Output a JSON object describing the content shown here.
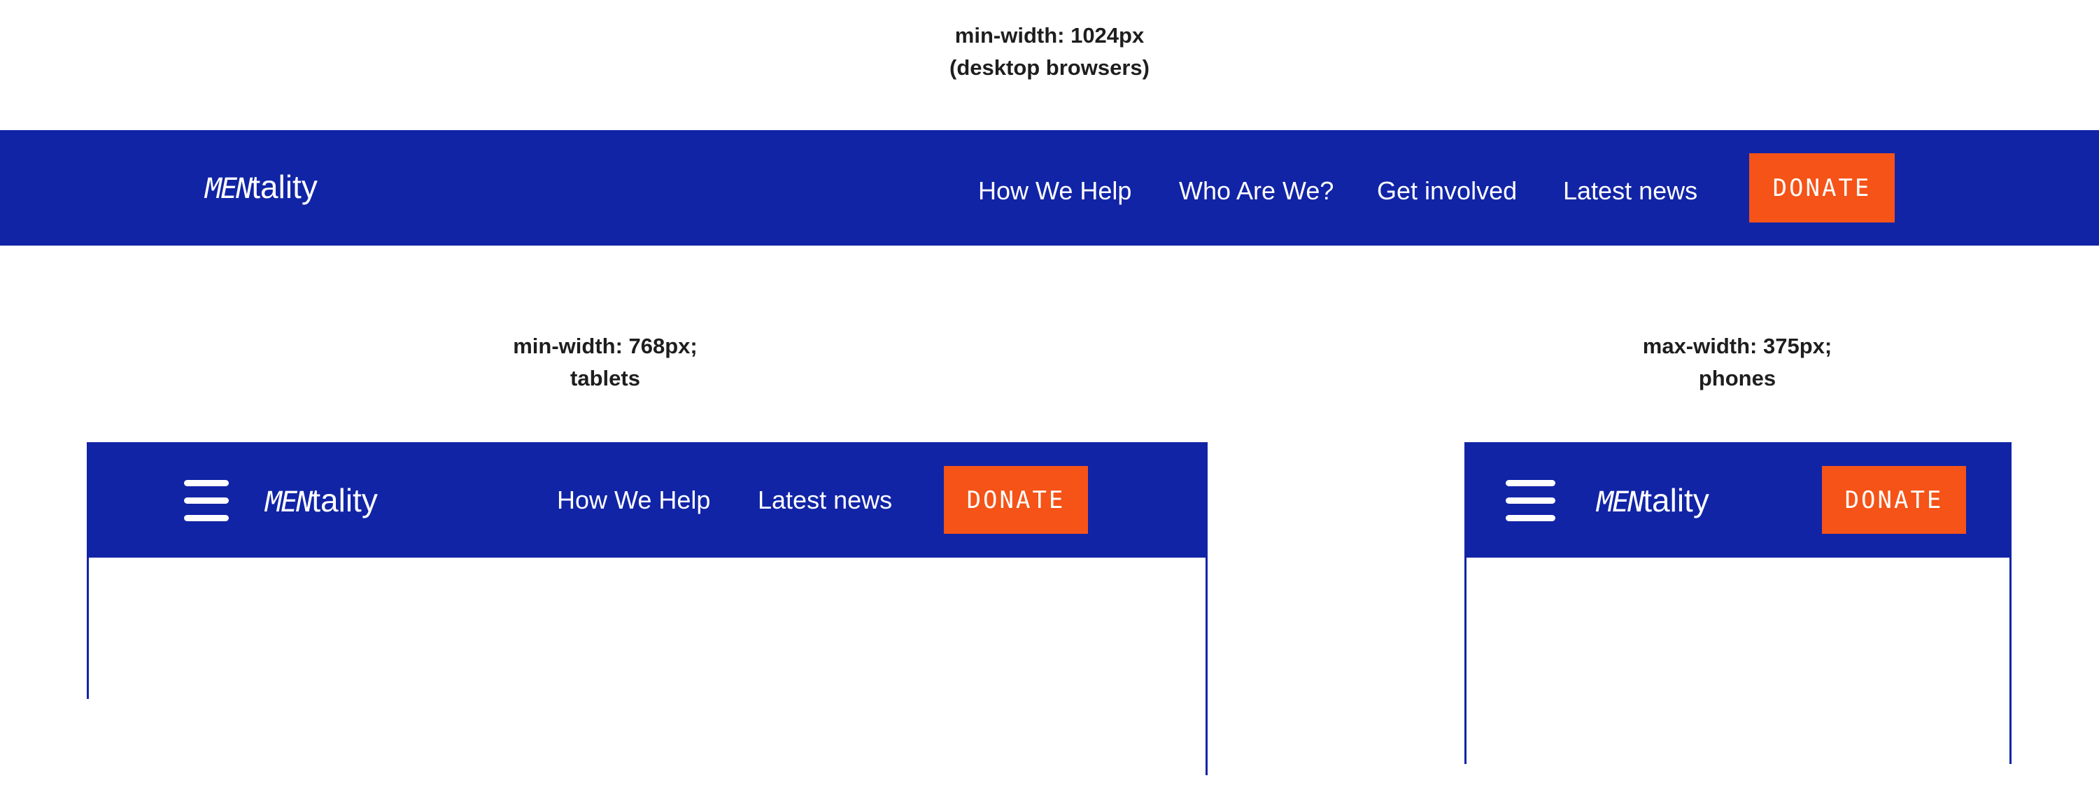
{
  "colors": {
    "brand_blue": "#1124a6",
    "donate_orange": "#f55317"
  },
  "desktop": {
    "caption_line1": "min-width: 1024px",
    "caption_line2": "(desktop browsers)",
    "logo_men": "MEN",
    "logo_rest": "tality",
    "nav": [
      "How We Help",
      "Who Are We?",
      "Get involved",
      "Latest news"
    ],
    "donate": "DONATE"
  },
  "tablet": {
    "caption_line1": "min-width: 768px;",
    "caption_line2": "tablets",
    "menu_icon": "hamburger-icon",
    "logo_men": "MEN",
    "logo_rest": "tality",
    "nav": [
      "How We Help",
      "Latest news"
    ],
    "donate": "DONATE"
  },
  "phone": {
    "caption_line1": "max-width: 375px;",
    "caption_line2": "phones",
    "menu_icon": "hamburger-icon",
    "logo_men": "MEN",
    "logo_rest": "tality",
    "donate": "DONATE"
  }
}
